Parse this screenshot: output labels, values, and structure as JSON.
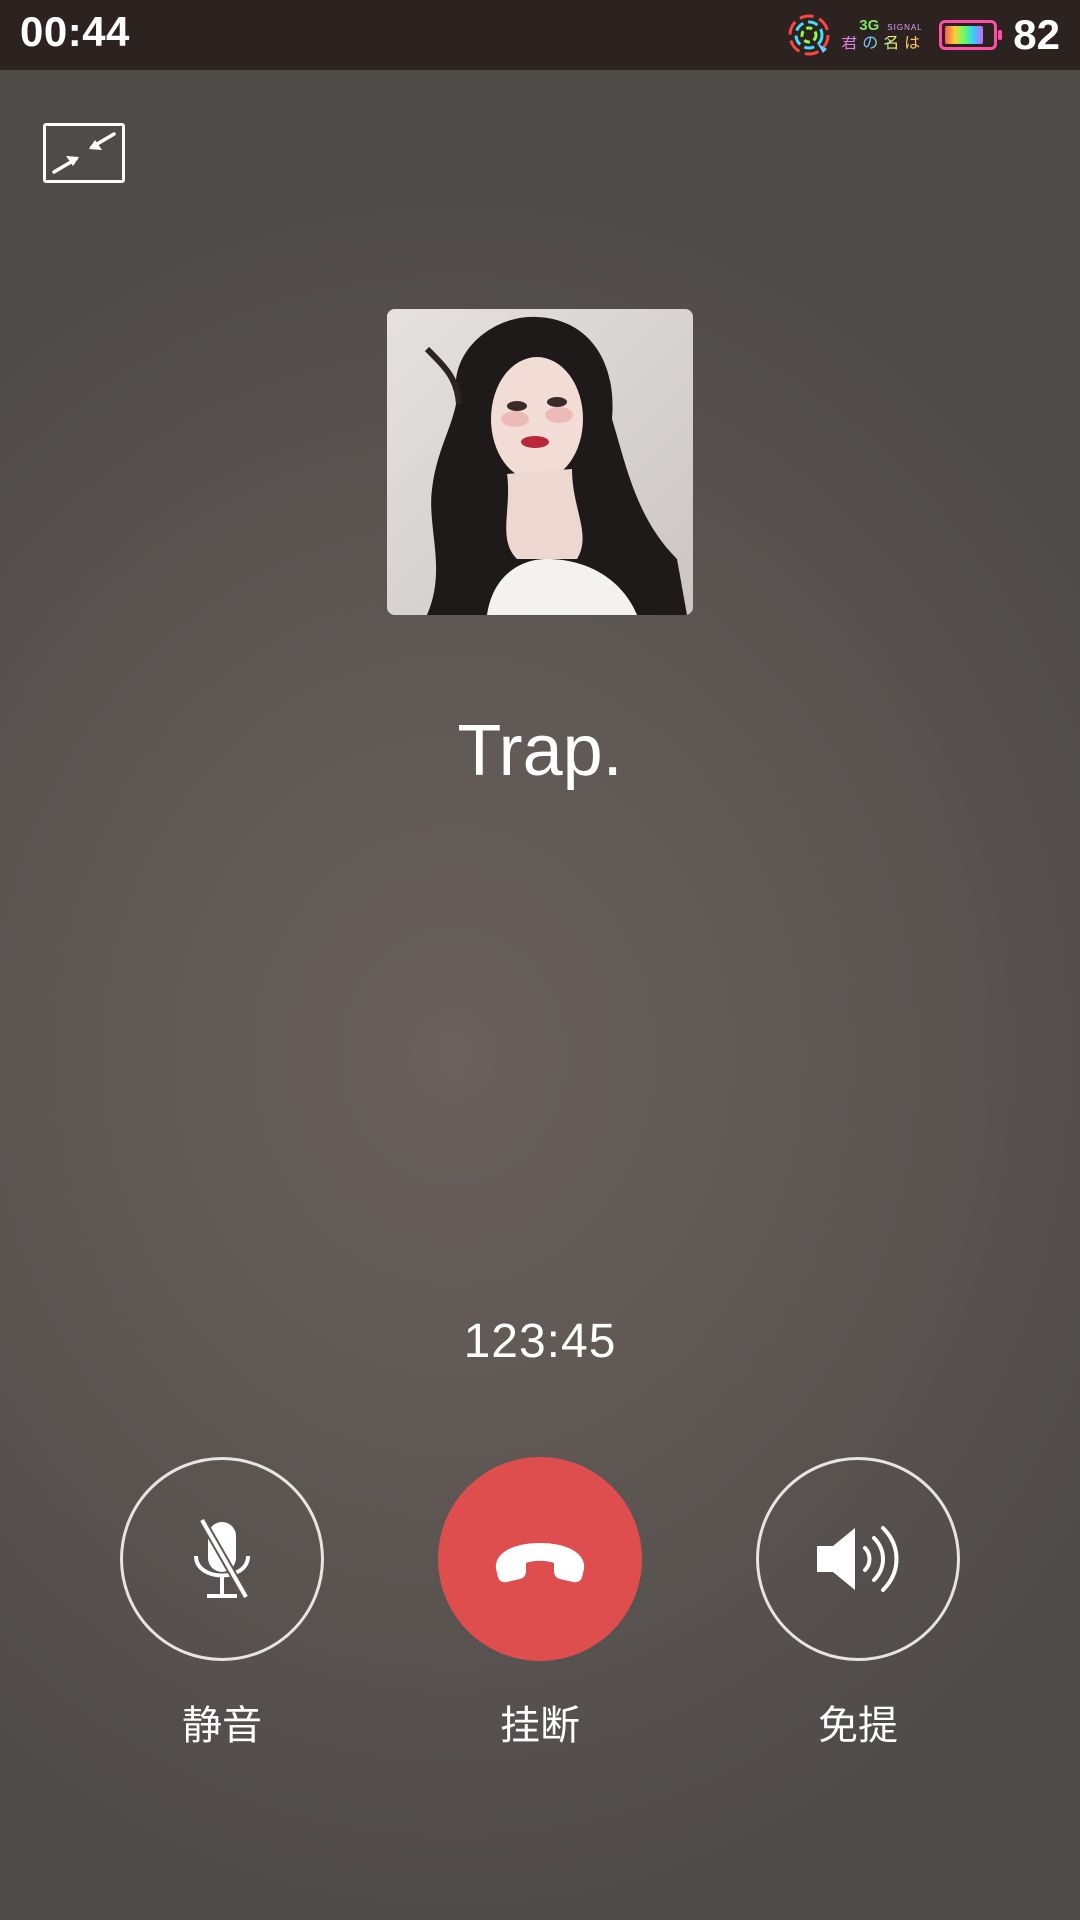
{
  "status_bar": {
    "time": "00:44",
    "network_type": "3G",
    "network_signal_label": "SIGNAL",
    "carrier_text": "君の名は",
    "battery_percent": "82",
    "battery_level": 0.82,
    "icons": [
      "signal-icon",
      "battery-icon"
    ]
  },
  "call": {
    "minimize_icon": "minimize-arrows-icon",
    "contact_name": "Trap.",
    "duration": "123:45"
  },
  "controls": {
    "mute_label": "静音",
    "hangup_label": "挂断",
    "speaker_label": "免提",
    "icons": [
      "mic-off-icon",
      "phone-hangup-icon",
      "speaker-icon"
    ]
  },
  "colors": {
    "status_bar_bg": "#2c2220",
    "hangup_red": "#de4e4e",
    "background": "#5c5552"
  }
}
